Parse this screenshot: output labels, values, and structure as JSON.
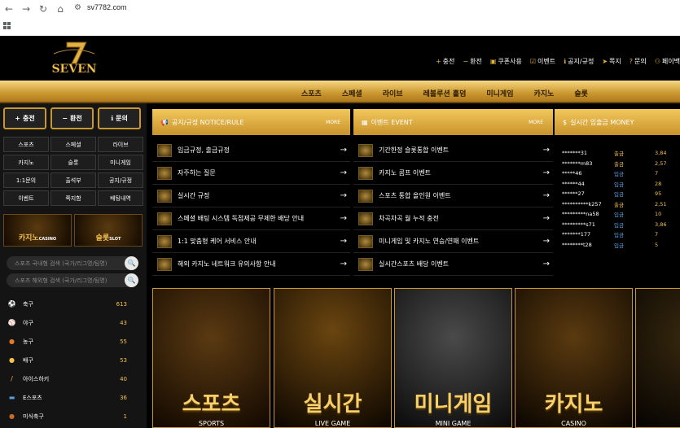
{
  "browser": {
    "url": "sv7782.com"
  },
  "logo": {
    "text": "SEVEN",
    "numeral": "7"
  },
  "top_menu": [
    {
      "icon": "+",
      "label": "충전"
    },
    {
      "icon": "−",
      "label": "환전"
    },
    {
      "icon": "▣",
      "label": "쿠폰사용"
    },
    {
      "icon": "☑",
      "label": "이벤트"
    },
    {
      "icon": "ℹ",
      "label": "공지/규정"
    },
    {
      "icon": "➤",
      "label": "쪽지"
    },
    {
      "icon": "?",
      "label": "문의"
    },
    {
      "icon": "⚇",
      "label": "페이백"
    }
  ],
  "main_nav": [
    "스포츠",
    "스페셜",
    "라이브",
    "레볼루션 홀덤",
    "미니게임",
    "카지노",
    "슬롯"
  ],
  "sidebar": {
    "big_buttons": [
      {
        "icon": "+",
        "label": "충전"
      },
      {
        "icon": "−",
        "label": "환전"
      },
      {
        "icon": "ℹ",
        "label": "문의"
      }
    ],
    "grid": [
      "스포츠",
      "스페셜",
      "라이브",
      "카지노",
      "슬롯",
      "미니게임",
      "1:1문의",
      "출석부",
      "공지/규정",
      "이벤트",
      "쪽지함",
      "배팅내역"
    ],
    "banners": [
      {
        "title": "카지노",
        "sub": "CASINO"
      },
      {
        "title": "슬롯",
        "sub": "SLOT"
      }
    ],
    "search1": "스포츠 국내형 검색 (국가/리그명/팀명)",
    "search2": "스포츠 해외형 검색 (국가/리그명/팀명)",
    "sports": [
      {
        "name": "축구",
        "count": "613",
        "color": "#fff",
        "icon": "⚽"
      },
      {
        "name": "야구",
        "count": "43",
        "color": "#fff",
        "icon": "⚾"
      },
      {
        "name": "농구",
        "count": "55",
        "color": "#e07b2a",
        "icon": "●"
      },
      {
        "name": "배구",
        "count": "53",
        "color": "#f2c14e",
        "icon": "●"
      },
      {
        "name": "아이스하키",
        "count": "40",
        "color": "#e6b43a",
        "icon": "/"
      },
      {
        "name": "E스포츠",
        "count": "36",
        "color": "#5aa0e0",
        "icon": "▬"
      },
      {
        "name": "미식축구",
        "count": "1",
        "color": "#c86a2a",
        "icon": "●"
      }
    ]
  },
  "notice": {
    "title": "공지/규정",
    "title_en": "NOTICE/RULE",
    "more": "MORE",
    "items": [
      "입금규정, 출금규정",
      "자주하는 질문",
      "실시간 규정",
      "스페셜 배팅 시스템 독점제공 무제한 배당 안내",
      "1:1 맞춤형 케어 서비스 안내",
      "해외 카지노 네트워크 유의사항 안내"
    ]
  },
  "event": {
    "title": "이벤트",
    "title_en": "EVENT",
    "more": "MORE",
    "items": [
      "기간한정 슬롯통합 이벤트",
      "카지노 콤프 이벤트",
      "스포츠 통합 올인원 이벤트",
      "차곡차곡 월 누적 충전",
      "미니게임 및 카지노 연승/연패 이벤트",
      "실시간스포츠 배당 이벤트"
    ]
  },
  "money": {
    "title": "실시간 입출금",
    "title_en": "MONEY",
    "rows": [
      {
        "user": "*******31",
        "kind": "출금",
        "amount": "3,84"
      },
      {
        "user": "*******m83",
        "kind": "출금",
        "amount": "2,57"
      },
      {
        "user": "*****46",
        "kind": "입금",
        "amount": "7"
      },
      {
        "user": "******44",
        "kind": "입금",
        "amount": "28"
      },
      {
        "user": "******27",
        "kind": "입금",
        "amount": "95"
      },
      {
        "user": "**********k257",
        "kind": "출금",
        "amount": "2,51"
      },
      {
        "user": "*********na58",
        "kind": "입금",
        "amount": "10"
      },
      {
        "user": "*********s71",
        "kind": "입금",
        "amount": "3,86"
      },
      {
        "user": "*******177",
        "kind": "입금",
        "amount": "7"
      },
      {
        "user": "********t28",
        "kind": "입금",
        "amount": "5"
      }
    ]
  },
  "cards": [
    {
      "title": "스포츠",
      "sub": "SPORTS"
    },
    {
      "title": "실시간",
      "sub": "LIVE GAME"
    },
    {
      "title": "미니게임",
      "sub": "MINI GAME"
    },
    {
      "title": "카지노",
      "sub": "CASINO"
    },
    {
      "title": "",
      "sub": ""
    }
  ]
}
